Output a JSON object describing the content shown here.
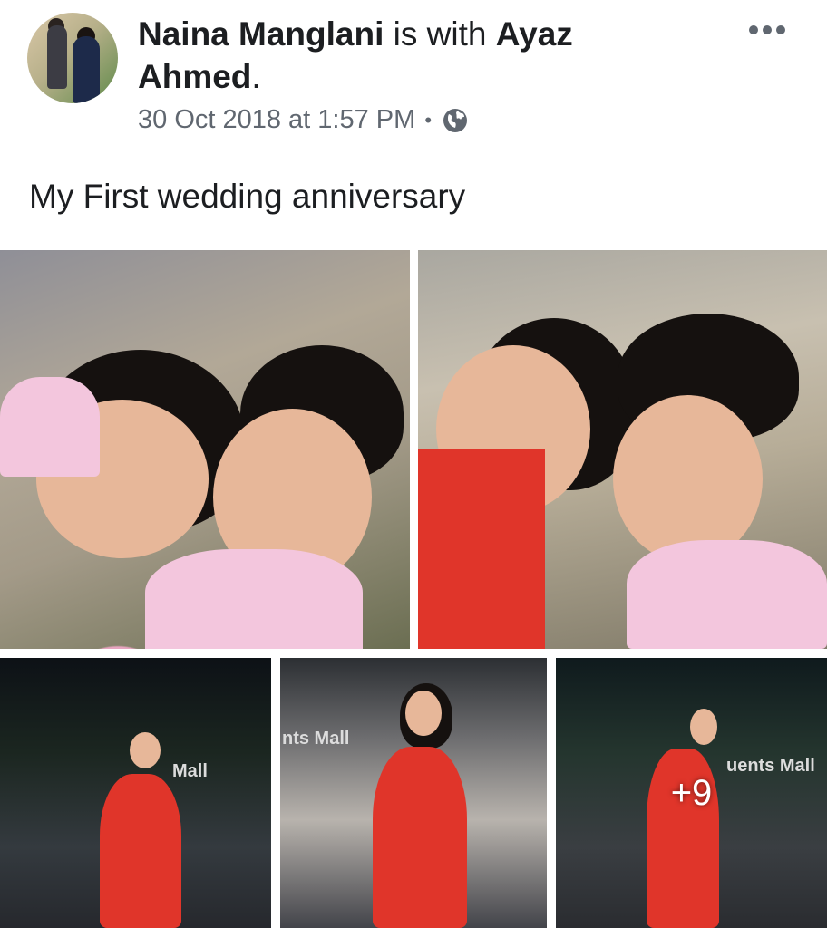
{
  "post": {
    "author": "Naina Manglani",
    "with_text": "is with",
    "tagged": "Ayaz Ahmed",
    "period": ".",
    "timestamp": "30 Oct 2018 at 1:57 PM",
    "separator": "•",
    "privacy_icon": "globe-icon",
    "menu_icon": "more-options-icon",
    "text": "My First wedding anniversary"
  },
  "photos": {
    "count_total": 14,
    "visible": 5,
    "more_label": "+9",
    "signs": [
      "nts Mall",
      "Mall",
      "uents Mall"
    ]
  },
  "colors": {
    "text_primary": "#1c1e21",
    "text_secondary": "#606770"
  }
}
